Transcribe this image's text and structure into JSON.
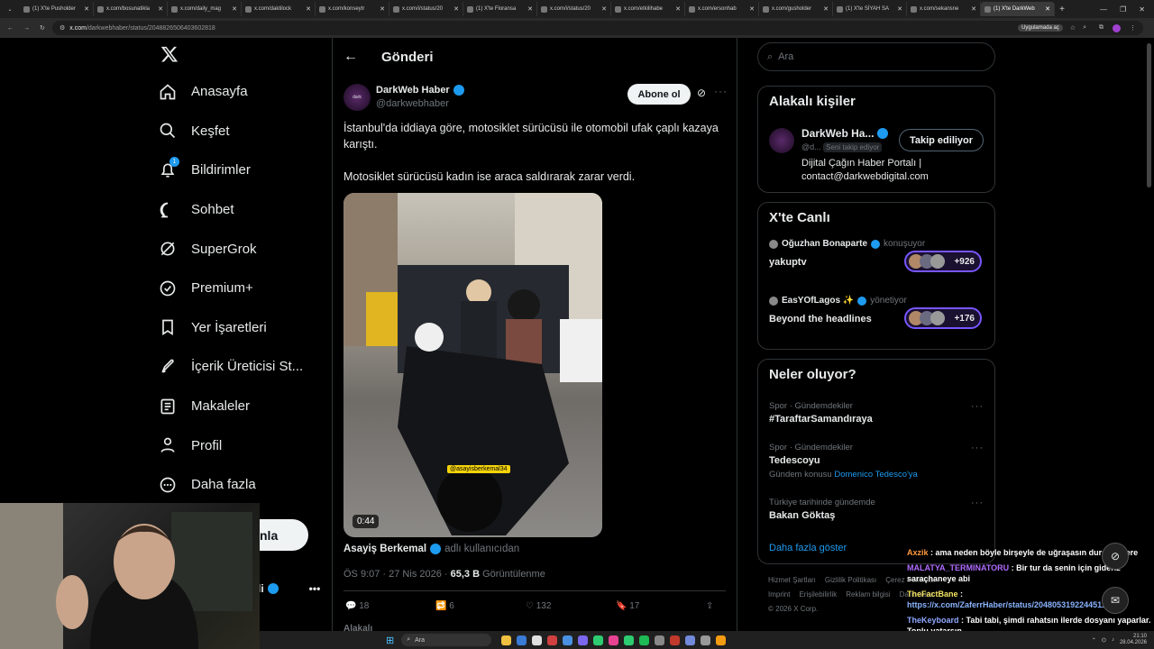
{
  "browser": {
    "tabs": [
      "(1) X'te Pusholder",
      "x.com/bosunatikla",
      "x.com/daily_mag",
      "x.com/daktilock",
      "x.com/konseytr",
      "x.com/i/status/20",
      "(1) X'te Floransa",
      "x.com/i/status/20",
      "x.com/etkilihabe",
      "x.com/ersonhab",
      "x.com/gusholder",
      "(1) X'te SİYAH SA",
      "x.com/sekansne",
      "(1) X'te DarkWeb"
    ],
    "url_host": "x.com",
    "url_path": "/darkwebhaber/status/2048826506403602818",
    "app_button": "Uygulamada aç"
  },
  "sidebar": {
    "logo": "X",
    "items": [
      {
        "label": "Anasayfa",
        "icon": "home-icon"
      },
      {
        "label": "Keşfet",
        "icon": "search-icon"
      },
      {
        "label": "Bildirimler",
        "icon": "bell-icon",
        "badge": "1"
      },
      {
        "label": "Sohbet",
        "icon": "chat-icon"
      },
      {
        "label": "SuperGrok",
        "icon": "grok-icon"
      },
      {
        "label": "Premium+",
        "icon": "verified-icon"
      },
      {
        "label": "Yer İşaretleri",
        "icon": "bookmark-icon"
      },
      {
        "label": "İçerik Üreticisi St...",
        "icon": "rocket-icon"
      },
      {
        "label": "Makaleler",
        "icon": "article-icon"
      },
      {
        "label": "Profil",
        "icon": "person-icon"
      },
      {
        "label": "Daha fazla",
        "icon": "more-circle-icon"
      }
    ],
    "post_button": "nla",
    "account_name": "li"
  },
  "post": {
    "header_title": "Gönderi",
    "author_name": "DarkWeb Haber",
    "author_handle": "@darkwebhaber",
    "follow_button": "Abone ol",
    "text1": "İstanbul'da iddiaya göre, motosiklet sürücüsü ile otomobil ufak çaplı kazaya karıştı.",
    "text2": "Motosiklet sürücüsü kadın ise araca saldırarak zarar verdi.",
    "video_duration": "0:44",
    "video_watermark": "@asayisberkemal34",
    "credit_name": "Asayiş Berkemal",
    "credit_suffix": "adlı kullanıcıdan",
    "time": "ÖS 9:07 · 27 Nis 2026",
    "views_count": "65,3 B",
    "views_label": "Görüntülenme",
    "replies": "18",
    "reposts": "6",
    "likes": "132",
    "bookmarks": "17",
    "reply_preview": "Alakalı"
  },
  "search": {
    "placeholder": "Ara"
  },
  "related": {
    "title": "Alakalı kişiler",
    "name": "DarkWeb Ha...",
    "handle": "@d...",
    "follows_you": "Seni takip ediyor",
    "button": "Takip ediliyor",
    "bio": "Dijital Çağın Haber Portalı | contact@darkwebdigital.com"
  },
  "live": {
    "title": "X'te Canlı",
    "items": [
      {
        "host": "Oğuzhan Bonaparte",
        "role": "konuşuyor",
        "topic": "yakuptv",
        "count": "+926"
      },
      {
        "host": "EasYOfLagos ✨",
        "role": "yönetiyor",
        "topic": "Beyond the headlines",
        "count": "+176"
      }
    ]
  },
  "trends": {
    "title": "Neler oluyor?",
    "items": [
      {
        "meta": "Spor · Gündemdekiler",
        "name": "#TaraftarSamandıraya",
        "extra": "",
        "link": ""
      },
      {
        "meta": "Spor · Gündemdekiler",
        "name": "Tedescoyu",
        "extra": "Gündem konusu",
        "link": "Domenico Tedesco'ya"
      },
      {
        "meta": "Türkiye tarihinde gündemde",
        "name": "Bakan Göktaş",
        "extra": "",
        "link": ""
      }
    ],
    "show_more": "Daha fazla göster"
  },
  "footer": {
    "links": [
      "Hizmet Şartları",
      "Gizlilik Politikası",
      "Çerez Politikası",
      "Imprint",
      "Erişilebilirlik",
      "Reklam bilgisi",
      "Daha fazla ..."
    ],
    "copyright": "© 2026 X Corp."
  },
  "chat": [
    {
      "user": "Axzik",
      "user_color": "#ff9a3c",
      "text": "ama neden böyle birşeyle de uğraşasın durdum yere"
    },
    {
      "user": "MALATYA_TERMINATORU",
      "user_color": "#b16cff",
      "text": "Bir tur da senin için gideriz saraçhaneye abi"
    },
    {
      "user": "TheFactBane",
      "user_color": "#f5e663",
      "text": "https://x.com/ZaferrHaber/status/2048053192244511012"
    },
    {
      "user": "TheKeyboard",
      "user_color": "#8fa8ff",
      "text": "Tabi tabi, şimdi rahatsın ilerde dosyanı yaparlar. Toplu yatarsın."
    }
  ],
  "taskbar": {
    "search": "Ara",
    "time": "21:10",
    "date": "28.04.2026"
  },
  "colors": {
    "accent": "#1d9bf0",
    "bg": "#000000",
    "live_border": "#7856ff"
  }
}
